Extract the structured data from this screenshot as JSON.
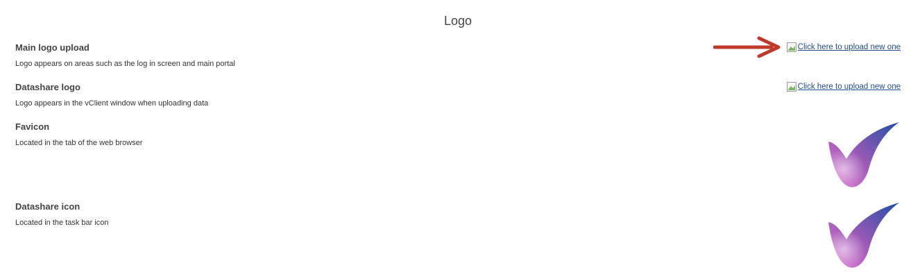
{
  "page": {
    "title": "Logo"
  },
  "settings": [
    {
      "title": "Main logo upload",
      "description": "Logo appears on areas such as the log in screen and main portal",
      "upload_link": "Click here to upload new one"
    },
    {
      "title": "Datashare logo",
      "description": "Logo appears in the vClient window when uploading data",
      "upload_link": "Click here to upload new one"
    },
    {
      "title": "Favicon",
      "description": "Located in the tab of the web browser"
    },
    {
      "title": "Datashare icon",
      "description": "Located in the task bar icon"
    }
  ],
  "colors": {
    "arrow": "#c0392b",
    "link": "#1f4e8c",
    "check_gradient_start": "#e57ed6",
    "check_gradient_mid": "#9b59b6",
    "check_gradient_end": "#1f4fa8"
  },
  "icons": {
    "arrow": "arrow-right-icon",
    "broken_image": "broken-image-icon",
    "favicon_preview": "checkmark-swoosh-icon",
    "datashare_icon_preview": "checkmark-swoosh-icon"
  }
}
